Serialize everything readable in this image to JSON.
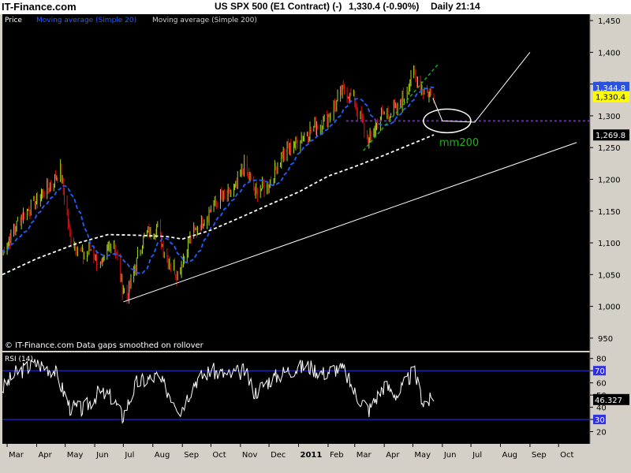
{
  "header": {
    "brand": "IT-Finance.com",
    "instrument": "US SPX 500 (E1 Contract) (-)",
    "quote": "1,330.4 (-0.90%)",
    "interval": "Daily",
    "time": "21:14"
  },
  "colors": {
    "background": "#000000",
    "price_up": "#a8d820",
    "price_down": "#e01010",
    "ma20": "#2060ff",
    "ma200": "#ffffff",
    "support": "#7a20c8",
    "channel": "#20b020",
    "rsi_line": "#ffffff",
    "rsi_bands": "#3030e0"
  },
  "chart_data": [
    {
      "type": "candlestick",
      "panel": "price",
      "legend": [
        "Price",
        "Moving average (Simple 20)",
        "Moving average (Simple 200)"
      ],
      "y_ticks": [
        "1,450",
        "1,400",
        "1,350",
        "1,300",
        "1,250",
        "1,200",
        "1,150",
        "1,100",
        "1,050",
        "1,000",
        "950"
      ],
      "ylim": [
        930,
        1460
      ],
      "x_ticks": [
        "Mar",
        "Apr",
        "May",
        "Jun",
        "Jul",
        "Aug",
        "Sep",
        "Oct",
        "Nov",
        "Dec",
        "2011",
        "Feb",
        "Mar",
        "Apr",
        "May",
        "Jun",
        "Jul",
        "Aug",
        "Sep",
        "Oct"
      ],
      "price_anchors": {
        "x": [
          "2010-02-24",
          "2010-03-15",
          "2010-04-15",
          "2010-04-26",
          "2010-05-06",
          "2010-05-20",
          "2010-05-28",
          "2010-06-08",
          "2010-06-20",
          "2010-06-30",
          "2010-07-05",
          "2010-07-15",
          "2010-07-23",
          "2010-08-05",
          "2010-08-15",
          "2010-08-27",
          "2010-09-10",
          "2010-09-25",
          "2010-10-10",
          "2010-10-25",
          "2010-11-05",
          "2010-11-16",
          "2010-11-30",
          "2010-12-15",
          "2010-12-31",
          "2011-01-15",
          "2011-01-27",
          "2011-02-10",
          "2011-02-18",
          "2011-03-01",
          "2011-03-16",
          "2011-03-28",
          "2011-04-15",
          "2011-05-02",
          "2011-05-12",
          "2011-05-23"
        ],
        "y": [
          1085,
          1140,
          1190,
          1215,
          1110,
          1080,
          1090,
          1060,
          1110,
          1030,
          1015,
          1070,
          1110,
          1125,
          1080,
          1050,
          1110,
          1140,
          1170,
          1180,
          1220,
          1180,
          1190,
          1240,
          1260,
          1280,
          1290,
          1320,
          1345,
          1320,
          1260,
          1300,
          1310,
          1365,
          1340,
          1330
        ]
      },
      "ma200_anchors": {
        "x": [
          "2010-02-24",
          "2010-04-01",
          "2010-05-15",
          "2010-06-15",
          "2010-07-15",
          "2010-08-15",
          "2010-09-01",
          "2010-10-01",
          "2010-11-01",
          "2010-12-01",
          "2011-01-01",
          "2011-02-01",
          "2011-03-01",
          "2011-04-01",
          "2011-05-23"
        ],
        "y": [
          1050,
          1075,
          1100,
          1113,
          1112,
          1110,
          1106,
          1120,
          1140,
          1160,
          1180,
          1205,
          1220,
          1238,
          1270
        ]
      },
      "last_price": "1,330.4",
      "axis_labels": [
        "1,344.8",
        "1,330.4",
        "1,269.8"
      ],
      "annotations": [
        "© IT-Finance.com  Data gaps smoothed on rollover",
        "mm200"
      ],
      "support_level": 1292,
      "trendline_lower": {
        "x": [
          "2010-07-01",
          "2011-10-20"
        ],
        "y": [
          1007,
          1258
        ]
      },
      "channel_line": {
        "x": [
          "2011-03-10",
          "2011-05-28"
        ],
        "y": [
          1245,
          1382
        ]
      },
      "forecast_path": {
        "x": [
          "2011-05-22",
          "2011-06-01",
          "2011-07-05",
          "2011-09-01"
        ],
        "y": [
          1328,
          1292,
          1290,
          1400
        ]
      }
    },
    {
      "type": "line",
      "panel": "rsi",
      "legend": [
        "RSI (14)"
      ],
      "y_ticks": [
        "80",
        "70",
        "60",
        "50",
        "40",
        "30",
        "20"
      ],
      "ylim": [
        10,
        85
      ],
      "bands": [
        70,
        30
      ],
      "last_value": "46.327",
      "rsi_anchors": {
        "x": [
          "2010-02-24",
          "2010-03-10",
          "2010-04-01",
          "2010-04-20",
          "2010-05-06",
          "2010-05-20",
          "2010-06-05",
          "2010-06-20",
          "2010-06-30",
          "2010-07-15",
          "2010-08-05",
          "2010-08-20",
          "2010-08-30",
          "2010-09-15",
          "2010-10-01",
          "2010-10-20",
          "2010-11-05",
          "2010-11-16",
          "2010-12-01",
          "2010-12-20",
          "2011-01-10",
          "2011-01-27",
          "2011-02-10",
          "2011-02-18",
          "2011-03-01",
          "2011-03-16",
          "2011-04-01",
          "2011-04-15",
          "2011-05-02",
          "2011-05-12",
          "2011-05-23"
        ],
        "y": [
          55,
          68,
          76,
          70,
          40,
          38,
          52,
          48,
          32,
          60,
          65,
          50,
          38,
          62,
          70,
          66,
          70,
          52,
          62,
          70,
          74,
          68,
          72,
          70,
          52,
          38,
          58,
          50,
          70,
          44,
          46
        ]
      }
    }
  ]
}
